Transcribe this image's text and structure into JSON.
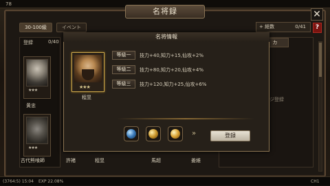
{
  "top": {
    "level": "78"
  },
  "window": {
    "title": "名将録",
    "close": "✕",
    "help": "?"
  },
  "tabs": [
    {
      "label": "30-100級"
    },
    {
      "label": "イベント"
    }
  ],
  "total": {
    "label": "+ 総数",
    "value": "0/41"
  },
  "left_panel": {
    "label": "登録",
    "count": "0/40",
    "card1_name": "黄忠",
    "card1_stars": "★★★",
    "card2_stars": "★★★"
  },
  "bottom_names": [
    "古代熊喰師",
    "許褚",
    "程昱",
    "馬超",
    "姜維"
  ],
  "right_panel": {
    "tab": "カ",
    "text": "ジ登録"
  },
  "modal": {
    "title": "名将情報",
    "hero_name": "程昱",
    "hero_stars": "★★★",
    "levels": [
      {
        "label": "等級一",
        "effect": "技力+40,知力+15,仙攻+2%"
      },
      {
        "label": "等級二",
        "effect": "技力+80,知力+20,仙攻+4%"
      },
      {
        "label": "等級三",
        "effect": "技力+120,知力+25,仙攻+6%"
      }
    ],
    "register_label": "登録",
    "arrow": "»"
  },
  "status_bar": {
    "left": "(3764:5) 15:04",
    "exp": "EXP  22.08%",
    "right": "CH1"
  }
}
